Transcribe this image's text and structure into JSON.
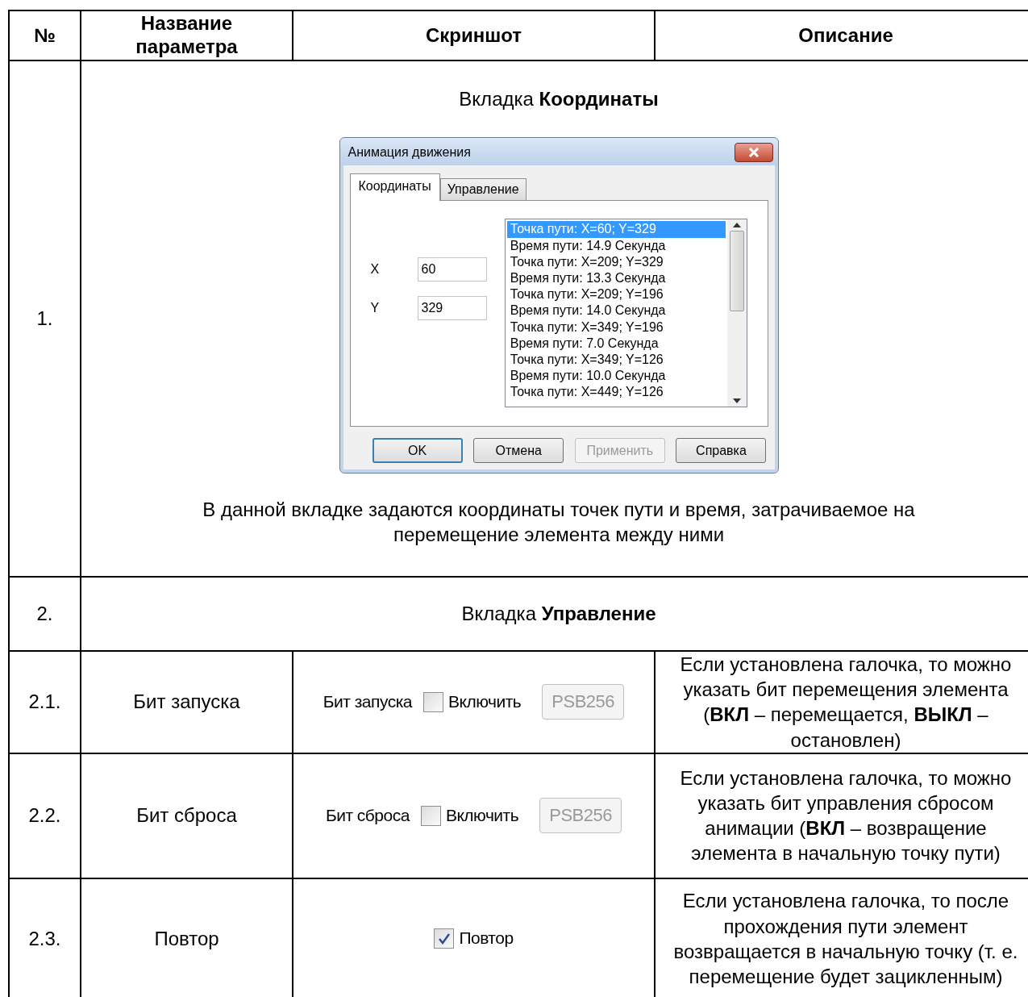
{
  "table": {
    "columns": [
      "№",
      "Название параметра",
      "Скриншот",
      "Описание"
    ],
    "rows": [
      {
        "kind": "section",
        "number": "1.",
        "heading": "Вкладка **Координаты**",
        "dialog": {
          "title": "Анимация движения",
          "tabs": [
            {
              "label": "Координаты",
              "selected": true
            },
            {
              "label": "Управление",
              "selected": false
            }
          ],
          "fields": [
            {
              "label": "X",
              "value": "60"
            },
            {
              "label": "Y",
              "value": "329"
            }
          ],
          "list": [
            {
              "text": "Точка пути: X=60; Y=329",
              "selected": true
            },
            {
              "text": "Время пути: 14.9 Секунда",
              "selected": false
            },
            {
              "text": "Точка пути: X=209; Y=329",
              "selected": false
            },
            {
              "text": "Время пути: 13.3 Секунда",
              "selected": false
            },
            {
              "text": "Точка пути: X=209; Y=196",
              "selected": false
            },
            {
              "text": "Время пути: 14.0 Секунда",
              "selected": false
            },
            {
              "text": "Точка пути: X=349; Y=196",
              "selected": false
            },
            {
              "text": "Время пути: 7.0 Секунда",
              "selected": false
            },
            {
              "text": "Точка пути: X=349; Y=126",
              "selected": false
            },
            {
              "text": "Время пути: 10.0 Секунда",
              "selected": false
            },
            {
              "text": "Точка пути: X=449; Y=126",
              "selected": false
            }
          ],
          "buttons": [
            {
              "label": "OK",
              "default": true,
              "disabled": false
            },
            {
              "label": "Отмена",
              "default": false,
              "disabled": false
            },
            {
              "label": "Применить",
              "default": false,
              "disabled": true
            },
            {
              "label": "Справка",
              "default": false,
              "disabled": false
            }
          ]
        },
        "caption": "В данной вкладке задаются координаты точек пути и время, затрачиваемое на перемещение элемента между ними"
      },
      {
        "kind": "section",
        "number": "2.",
        "heading": "Вкладка **Управление**"
      },
      {
        "kind": "param",
        "number": "2.1.",
        "name": "Бит запуска",
        "control": {
          "label": "Бит запуска",
          "checkbox_label": "Включить",
          "checked": false,
          "field": "PSB256"
        },
        "description": "Если установлена галочка, то можно указать бит перемещения элемента (**ВКЛ** – перемещается, **ВЫКЛ** – остановлен)"
      },
      {
        "kind": "param",
        "number": "2.2.",
        "name": "Бит сброса",
        "control": {
          "label": "Бит сброса",
          "checkbox_label": "Включить",
          "checked": false,
          "field": "PSB256"
        },
        "description": "Если установлена галочка, то можно указать бит управления сбросом анимации (**ВКЛ** – возвращение элемента в начальную точку пути)"
      },
      {
        "kind": "param",
        "number": "2.3.",
        "name": "Повтор",
        "control": {
          "checkbox_label": "Повтор",
          "checked": true
        },
        "description": "Если установлена галочка, то после прохождения пути элемент возвращается в начальную точку (т. е. перемещение будет зацикленным)"
      }
    ]
  }
}
